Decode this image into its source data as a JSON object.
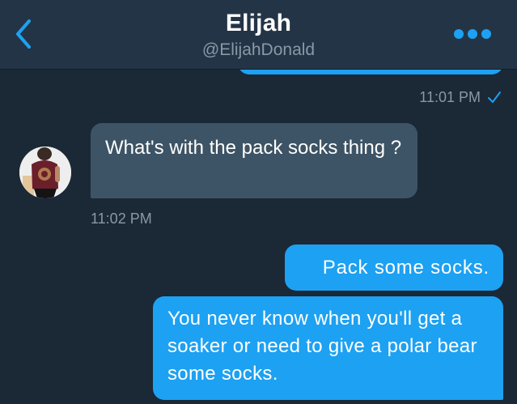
{
  "header": {
    "name": "Elijah",
    "handle": "@ElijahDonald",
    "back_icon": "chevron-left-icon",
    "more_icon": "more-dots-icon",
    "accent_color": "#1da1f2"
  },
  "messages": [
    {
      "direction": "outgoing",
      "text": "",
      "timestamp": "11:01 PM",
      "status_icon": "check-icon"
    },
    {
      "direction": "incoming",
      "text": "What's with the pack socks thing ?",
      "timestamp": "11:02 PM",
      "avatar_icon": "avatar-icon"
    },
    {
      "direction": "outgoing",
      "text": "Pack some socks."
    },
    {
      "direction": "outgoing",
      "text": "You never know when you'll get a soaker or need to give a polar bear some socks."
    }
  ]
}
